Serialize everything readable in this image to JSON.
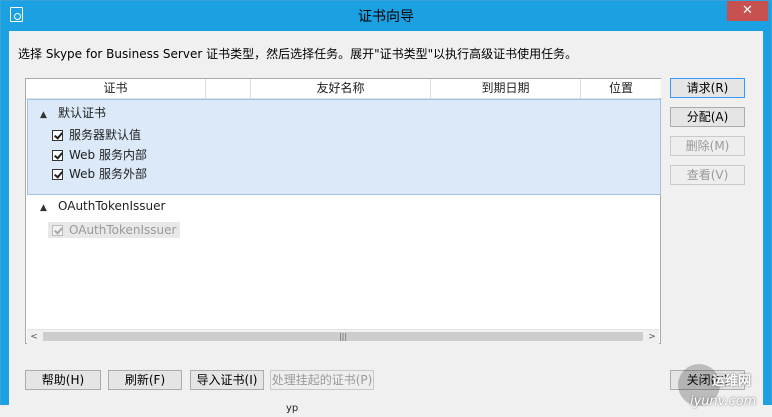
{
  "window": {
    "title": "证书向导",
    "close_label": "✕"
  },
  "instruction": "选择 Skype for Business Server 证书类型，然后选择任务。展开\"证书类型\"以执行高级证书使用任务。",
  "columns": [
    "证书",
    "",
    "友好名称",
    "到期日期",
    "位置"
  ],
  "groups": [
    {
      "label": "默认证书",
      "items": [
        "服务器默认值",
        "Web 服务内部",
        "Web 服务外部"
      ]
    },
    {
      "label": "OAuthTokenIssuer",
      "items": [
        "OAuthTokenIssuer"
      ]
    }
  ],
  "scrollbar": {
    "left_arrow": "<",
    "right_arrow": ">",
    "thumb_grip": "|||"
  },
  "side_buttons": {
    "request": "请求(R)",
    "assign": "分配(A)",
    "delete": "删除(M)",
    "view": "查看(V)"
  },
  "bottom_buttons": {
    "help": "帮助(H)",
    "refresh": "刷新(F)",
    "import": "导入证书(I)",
    "pending": "处理挂起的证书(P)",
    "close": "关闭(C)"
  },
  "watermark": {
    "cn": "运维网",
    "url": "iyunv.com"
  },
  "bottom_fragment": "yp"
}
